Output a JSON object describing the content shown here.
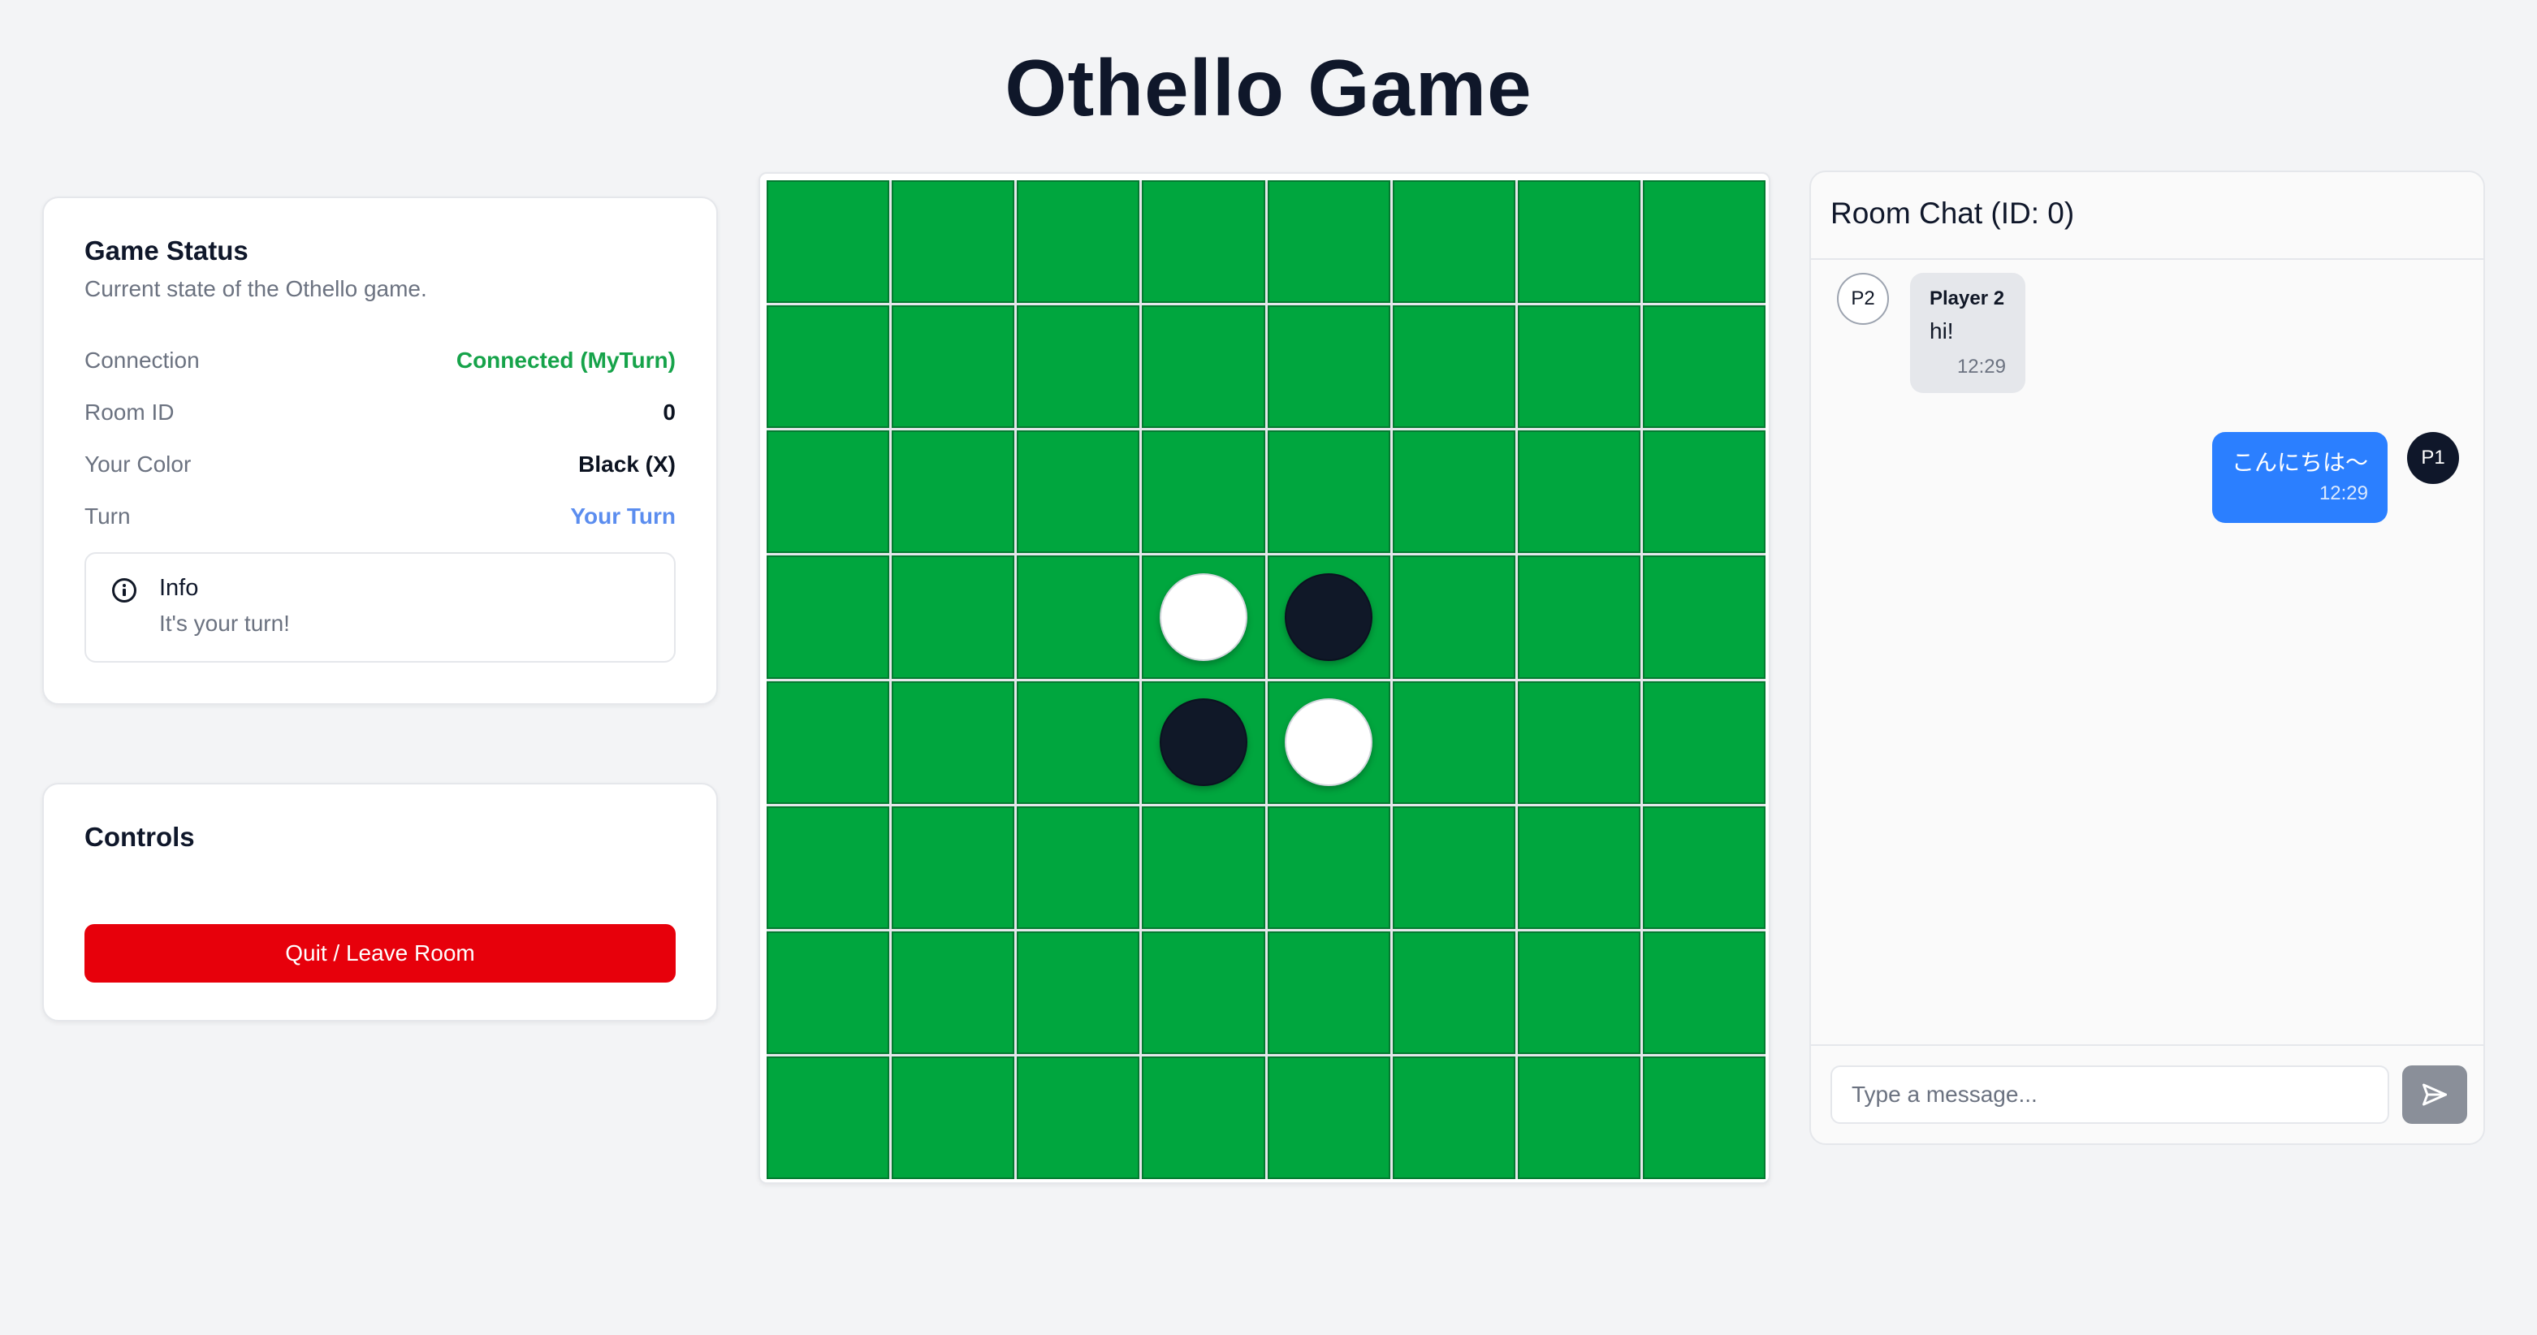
{
  "page": {
    "title": "Othello Game"
  },
  "status": {
    "title": "Game Status",
    "subtitle": "Current state of the Othello game.",
    "rows": [
      {
        "label": "Connection",
        "value": "Connected (MyTurn)",
        "color": "#16a34a"
      },
      {
        "label": "Room ID",
        "value": "0",
        "color": "#0b1220"
      },
      {
        "label": "Your Color",
        "value": "Black (X)",
        "color": "#0b1220"
      },
      {
        "label": "Turn",
        "value": "Your Turn",
        "color": "#5b8def"
      }
    ],
    "info": {
      "icon": "info-circle-icon",
      "title": "Info",
      "text": "It's your turn!"
    }
  },
  "controls": {
    "title": "Controls",
    "quit_label": "Quit / Leave Room",
    "quit_color": "#e7000b"
  },
  "board": {
    "size": 8,
    "cell_color": "#00a63e",
    "discs": [
      {
        "row": 3,
        "col": 3,
        "color": "white"
      },
      {
        "row": 3,
        "col": 4,
        "color": "black"
      },
      {
        "row": 4,
        "col": 3,
        "color": "black"
      },
      {
        "row": 4,
        "col": 4,
        "color": "white"
      }
    ]
  },
  "chat": {
    "title": "Room Chat (ID: 0)",
    "messages": [
      {
        "avatar": "P2",
        "sender": "Player 2",
        "text": "hi!",
        "time": "12:29"
      },
      {
        "avatar": "P1",
        "text": "こんにちは〜",
        "time": "12:29"
      }
    ],
    "input_placeholder": "Type a message...",
    "send_icon": "send-icon"
  }
}
